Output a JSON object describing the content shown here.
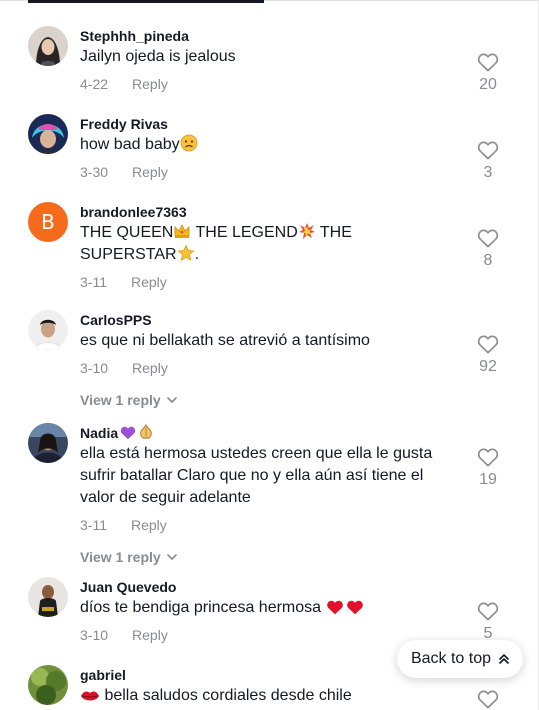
{
  "comments": [
    {
      "username": "Stephhh_pineda",
      "text": "Jailyn ojeda is jealous",
      "date": "4-22",
      "reply_label": "Reply",
      "likes": "20"
    },
    {
      "username": "Freddy Rivas",
      "text": "how bad baby",
      "text_emoji": "sad-face",
      "date": "3-30",
      "reply_label": "Reply",
      "likes": "3"
    },
    {
      "username": "brandonlee7363",
      "avatar_letter": "B",
      "text_line1_a": "THE QUEEN",
      "text_line1_b": " THE LEGEND",
      "text_line1_c": " THE",
      "text_line2_a": "SUPERSTAR",
      "text_line2_b": ".",
      "date": "3-11",
      "reply_label": "Reply",
      "likes": "8"
    },
    {
      "username": "CarlosPPS",
      "text": "es que ni bellakath se atrevió a tantísimo",
      "date": "3-10",
      "reply_label": "Reply",
      "likes": "92",
      "view_replies": "View 1 reply"
    },
    {
      "username": "Nadia",
      "text": "ella está hermosa ustedes creen que ella le gusta sufrir batallar Claro que no y ella aún así tiene el valor de seguir adelante",
      "date": "3-11",
      "reply_label": "Reply",
      "likes": "19",
      "view_replies": "View 1 reply"
    },
    {
      "username": "Juan Quevedo",
      "text": "díos te bendiga princesa hermosa",
      "date": "3-10",
      "reply_label": "Reply",
      "likes": "5"
    },
    {
      "username": "gabriel",
      "text": "bella saludos cordiales desde chile"
    }
  ],
  "back_to_top": "Back to top",
  "colors": {
    "text": "#161823",
    "muted": "#8a8b91",
    "letter_avatar": "#f36b1b"
  },
  "icons": [
    "heart-outline-icon",
    "chevron-down-icon",
    "double-chevron-up-icon",
    "crown-emoji",
    "collision-emoji",
    "star-emoji",
    "purple-heart-emoji",
    "onion-emoji",
    "red-heart-emoji",
    "lips-emoji"
  ]
}
